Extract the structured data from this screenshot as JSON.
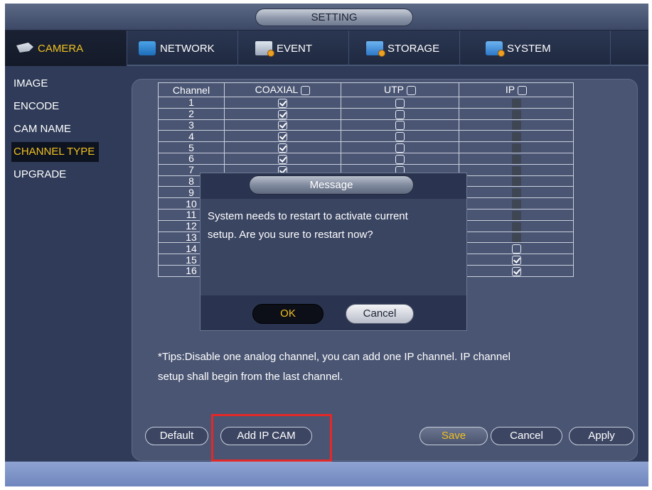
{
  "window": {
    "title": "SETTING"
  },
  "tabs": [
    {
      "label": "CAMERA",
      "icon": "camera-icon",
      "active": true
    },
    {
      "label": "NETWORK",
      "icon": "network-icon",
      "active": false
    },
    {
      "label": "EVENT",
      "icon": "event-icon",
      "active": false
    },
    {
      "label": "STORAGE",
      "icon": "storage-icon",
      "active": false
    },
    {
      "label": "SYSTEM",
      "icon": "system-icon",
      "active": false
    }
  ],
  "menu": [
    {
      "label": "IMAGE",
      "active": false
    },
    {
      "label": "ENCODE",
      "active": false
    },
    {
      "label": "CAM NAME",
      "active": false
    },
    {
      "label": "CHANNEL TYPE",
      "active": true
    },
    {
      "label": "UPGRADE",
      "active": false
    }
  ],
  "table": {
    "headers": [
      "Channel",
      "COAXIAL",
      "UTP",
      "IP"
    ],
    "rows": [
      {
        "channel": "1",
        "coaxial": "checked",
        "utp": "unchecked",
        "ip": "disabled"
      },
      {
        "channel": "2",
        "coaxial": "checked",
        "utp": "unchecked",
        "ip": "disabled"
      },
      {
        "channel": "3",
        "coaxial": "checked",
        "utp": "unchecked",
        "ip": "disabled"
      },
      {
        "channel": "4",
        "coaxial": "checked",
        "utp": "unchecked",
        "ip": "disabled"
      },
      {
        "channel": "5",
        "coaxial": "checked",
        "utp": "unchecked",
        "ip": "disabled"
      },
      {
        "channel": "6",
        "coaxial": "checked",
        "utp": "unchecked",
        "ip": "disabled"
      },
      {
        "channel": "7",
        "coaxial": "checked",
        "utp": "unchecked",
        "ip": "disabled"
      },
      {
        "channel": "8",
        "coaxial": "checked",
        "utp": "unchecked",
        "ip": "disabled"
      },
      {
        "channel": "9",
        "coaxial": "checked",
        "utp": "unchecked",
        "ip": "disabled"
      },
      {
        "channel": "10",
        "coaxial": "checked",
        "utp": "unchecked",
        "ip": "disabled"
      },
      {
        "channel": "11",
        "coaxial": "checked",
        "utp": "unchecked",
        "ip": "disabled"
      },
      {
        "channel": "12",
        "coaxial": "checked",
        "utp": "unchecked",
        "ip": "disabled"
      },
      {
        "channel": "13",
        "coaxial": "checked",
        "utp": "unchecked",
        "ip": "disabled"
      },
      {
        "channel": "14",
        "coaxial": "checked",
        "utp": "unchecked",
        "ip": "unchecked"
      },
      {
        "channel": "15",
        "coaxial": "disabled",
        "utp": "disabled",
        "ip": "checked"
      },
      {
        "channel": "16",
        "coaxial": "disabled",
        "utp": "disabled",
        "ip": "checked"
      }
    ]
  },
  "tips": {
    "line1": "*Tips:Disable one analog channel, you can add one IP channel. IP channel",
    "line2": "setup shall begin from the last channel."
  },
  "buttons": {
    "default": "Default",
    "add_ip_cam": "Add IP CAM",
    "save": "Save",
    "cancel": "Cancel",
    "apply": "Apply"
  },
  "dialog": {
    "title": "Message",
    "line1": "System needs to restart to activate current",
    "line2": "setup. Are you sure to restart now?",
    "ok": "OK",
    "cancel": "Cancel"
  },
  "colors": {
    "accent": "#f0c020",
    "background": "#2f3b58",
    "panel": "#4a5573",
    "highlight": "#e32828"
  }
}
